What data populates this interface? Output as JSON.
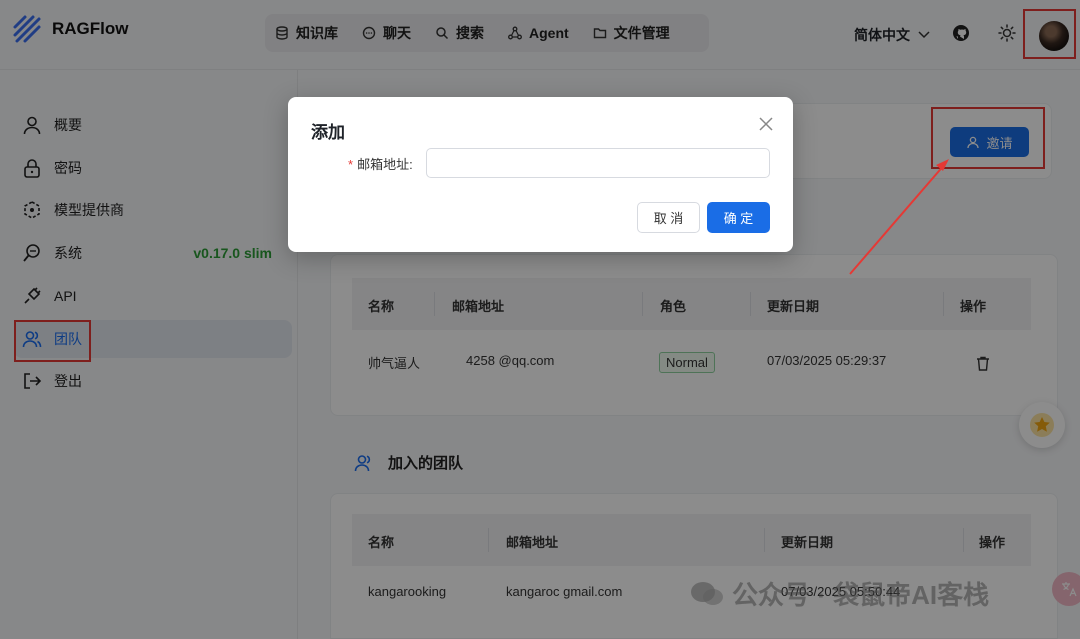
{
  "header": {
    "logo_text": "RAGFlow",
    "nav": [
      {
        "label": "知识库",
        "icon": "database-icon"
      },
      {
        "label": "聊天",
        "icon": "chat-bubble-icon"
      },
      {
        "label": "搜索",
        "icon": "search-icon"
      },
      {
        "label": "Agent",
        "icon": "agent-graph-icon"
      },
      {
        "label": "文件管理",
        "icon": "folder-icon"
      }
    ],
    "language": "简体中文"
  },
  "sidebar": {
    "items": [
      {
        "label": "概要",
        "icon": "user-icon"
      },
      {
        "label": "密码",
        "icon": "lock-icon"
      },
      {
        "label": "模型提供商",
        "icon": "model-provider-icon"
      },
      {
        "label": "系统",
        "icon": "system-icon"
      },
      {
        "label": "API",
        "icon": "plug-icon"
      },
      {
        "label": "团队",
        "icon": "team-icon"
      },
      {
        "label": "登出",
        "icon": "logout-icon"
      }
    ],
    "version": "v0.17.0 slim"
  },
  "main": {
    "invite_label": "邀请",
    "members_table": {
      "headers": [
        "名称",
        "邮箱地址",
        "角色",
        "更新日期",
        "操作"
      ],
      "rows": [
        {
          "name": "帅气逼人",
          "email": "4258          @qq.com",
          "role": "Normal",
          "updated": "07/03/2025 05:29:37"
        }
      ]
    },
    "joined_section_title": "加入的团队",
    "joined_table": {
      "headers": [
        "名称",
        "邮箱地址",
        "更新日期",
        "操作"
      ],
      "rows": [
        {
          "name": "kangarooking",
          "email": "kangaroc          gmail.com",
          "updated": "07/03/2025 05:50:44"
        }
      ]
    }
  },
  "modal": {
    "title": "添加",
    "email_label": "邮箱地址",
    "email_value": "",
    "cancel_label": "取 消",
    "ok_label": "确 定"
  },
  "watermark": "公众号 · 袋鼠帝AI客栈",
  "colors": {
    "accent": "#1a6de6",
    "highlight": "#e53935",
    "version": "#2d9d37"
  }
}
